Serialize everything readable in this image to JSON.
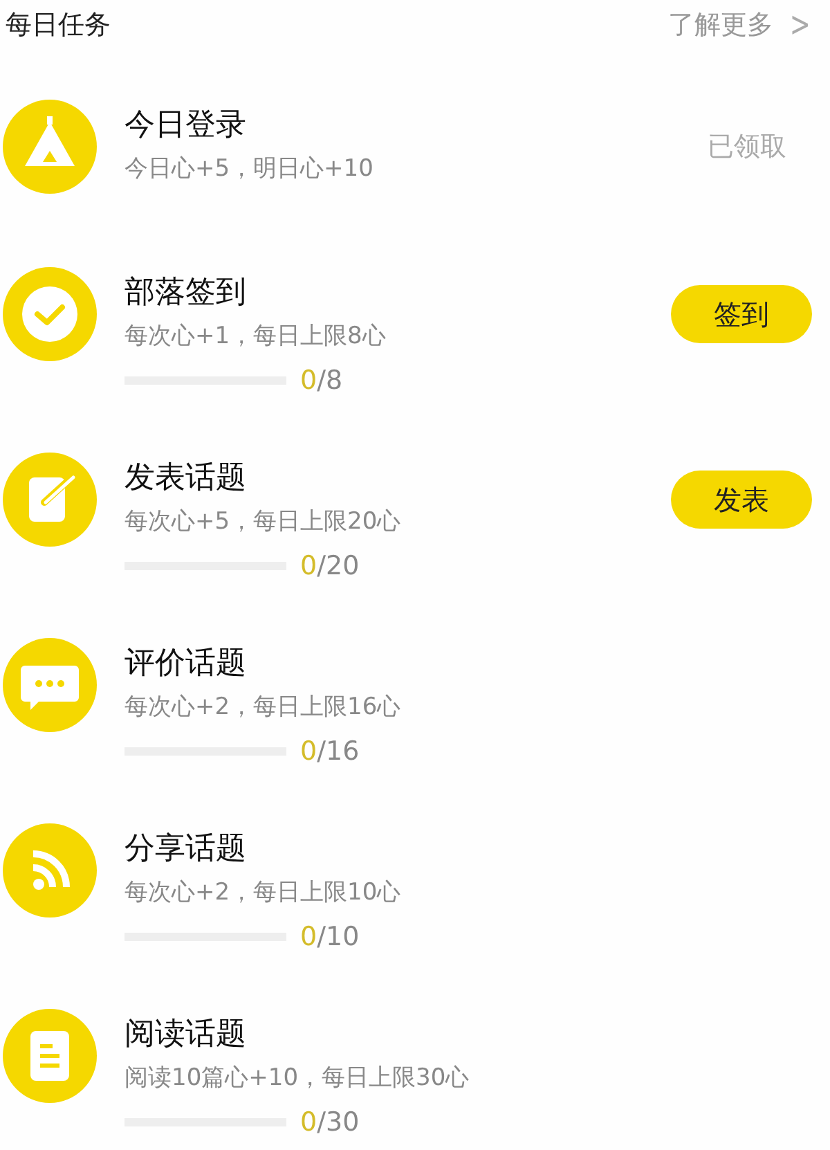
{
  "header": {
    "title": "每日任务",
    "more_link": "了解更多",
    "chevron": ">"
  },
  "tasks": [
    {
      "kind": "tent",
      "title": "今日登录",
      "reward": "今日心+5，明日心+10",
      "action": {
        "kind": "claimed",
        "label": "已领取"
      }
    },
    {
      "kind": "check",
      "title": "部落签到",
      "reward": "每次心+1，每日上限8心",
      "action": {
        "kind": "button",
        "label": "签到"
      },
      "progress": {
        "level": 0,
        "done": "0",
        "rest": "/8"
      }
    },
    {
      "kind": "edit",
      "title": "发表话题",
      "reward": "每次心+5，每日上限20心",
      "action": {
        "kind": "button",
        "label": "发表"
      },
      "progress": {
        "level": 0,
        "done": "0",
        "rest": "/20"
      }
    },
    {
      "kind": "chat",
      "title": "评价话题",
      "reward": "每次心+2，每日上限16心",
      "progress": {
        "level": 0,
        "done": "0",
        "rest": "/16"
      }
    },
    {
      "kind": "rss",
      "title": "分享话题",
      "reward": "每次心+2，每日上限10心",
      "progress": {
        "level": 0,
        "done": "0",
        "rest": "/10"
      }
    },
    {
      "kind": "document",
      "title": "阅读话题",
      "reward": "阅读10篇心+10，每日上限30心",
      "progress": {
        "level": 0,
        "done": "0",
        "rest": "/30"
      }
    }
  ]
}
